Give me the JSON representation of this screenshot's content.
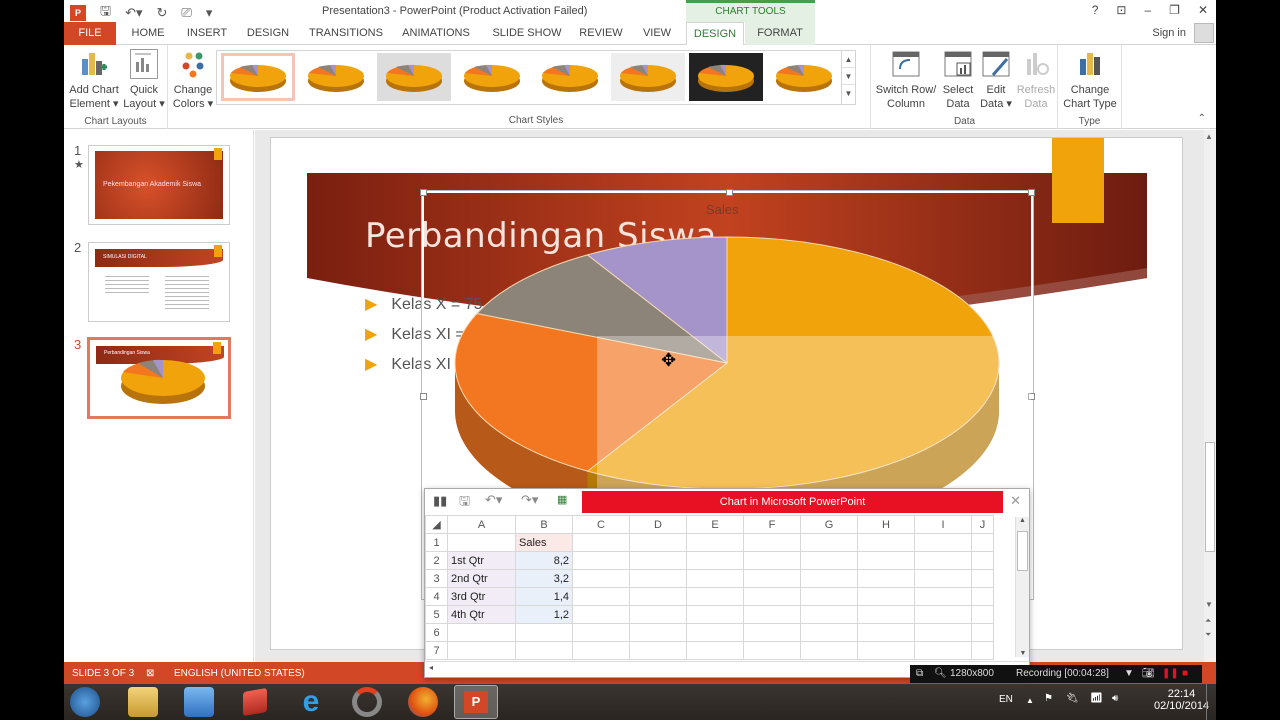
{
  "window": {
    "title": "Presentation3 - PowerPoint (Product Activation Failed)",
    "context_tab_group": "CHART TOOLS",
    "controls": {
      "help": "?",
      "ribbon_display": "⊡",
      "minimize": "–",
      "restore": "❐",
      "close": "✕"
    },
    "sign_in": "Sign in"
  },
  "tabs": [
    {
      "label": "FILE"
    },
    {
      "label": "HOME"
    },
    {
      "label": "INSERT"
    },
    {
      "label": "DESIGN"
    },
    {
      "label": "TRANSITIONS"
    },
    {
      "label": "ANIMATIONS"
    },
    {
      "label": "SLIDE SHOW"
    },
    {
      "label": "REVIEW"
    },
    {
      "label": "VIEW"
    },
    {
      "label": "DESIGN",
      "active": true,
      "context": true
    },
    {
      "label": "FORMAT",
      "context": true
    }
  ],
  "ribbon": {
    "chart_layouts": {
      "group_label": "Chart Layouts",
      "add_chart_element": [
        "Add Chart",
        "Element ▾"
      ],
      "quick_layout": [
        "Quick",
        "Layout ▾"
      ]
    },
    "change_colors": [
      "Change",
      "Colors ▾"
    ],
    "chart_styles": {
      "group_label": "Chart Styles",
      "style_count": 8,
      "selected_index": 0
    },
    "data": {
      "group_label": "Data",
      "switch_row_column": [
        "Switch Row/",
        "Column"
      ],
      "select_data": [
        "Select",
        "Data"
      ],
      "edit_data": [
        "Edit",
        "Data ▾"
      ],
      "refresh_data": [
        "Refresh",
        "Data"
      ]
    },
    "type": {
      "group_label": "Type",
      "change_chart_type": [
        "Change",
        "Chart Type"
      ]
    }
  },
  "slides_pane": [
    {
      "number": "1",
      "title": "Pekembangan Akademik Siswa",
      "has_animation": true
    },
    {
      "number": "2",
      "title": "SIMULASI DIGITAL"
    },
    {
      "number": "3",
      "title": "Perbandingan Siswa",
      "selected": true
    }
  ],
  "slide": {
    "title": "Perbandingan Siswa",
    "bullets": [
      "Kelas X = 75",
      "Kelas XI =",
      "Kelas XI"
    ],
    "chart_title": "Sales"
  },
  "chart_data": {
    "type": "pie",
    "title": "Sales",
    "categories": [
      "1st Qtr",
      "2nd Qtr",
      "3rd Qtr",
      "4th Qtr"
    ],
    "values": [
      8.2,
      3.2,
      1.4,
      1.2
    ],
    "colors": [
      "#f0a30a",
      "#f37721",
      "#8c8479",
      "#a594c9"
    ]
  },
  "datasheet": {
    "title": "Chart in Microsoft PowerPoint",
    "columns": [
      "A",
      "B",
      "C",
      "D",
      "E",
      "F",
      "G",
      "H",
      "I",
      "J"
    ],
    "rows": [
      {
        "n": "1",
        "a": "",
        "b": "Sales"
      },
      {
        "n": "2",
        "a": "1st Qtr",
        "b": "8,2"
      },
      {
        "n": "3",
        "a": "2nd Qtr",
        "b": "3,2"
      },
      {
        "n": "4",
        "a": "3rd Qtr",
        "b": "1,4"
      },
      {
        "n": "5",
        "a": "4th Qtr",
        "b": "1,2"
      },
      {
        "n": "6",
        "a": "",
        "b": ""
      },
      {
        "n": "7",
        "a": "",
        "b": ""
      }
    ]
  },
  "status": {
    "slide": "SLIDE 3 OF 3",
    "language": "ENGLISH (UNITED STATES)"
  },
  "recorder": {
    "resolution": "1280x800",
    "recording": "Recording [00:04:28]"
  },
  "taskbar": {
    "language": "EN",
    "time": "22:14",
    "date": "02/10/2014"
  }
}
